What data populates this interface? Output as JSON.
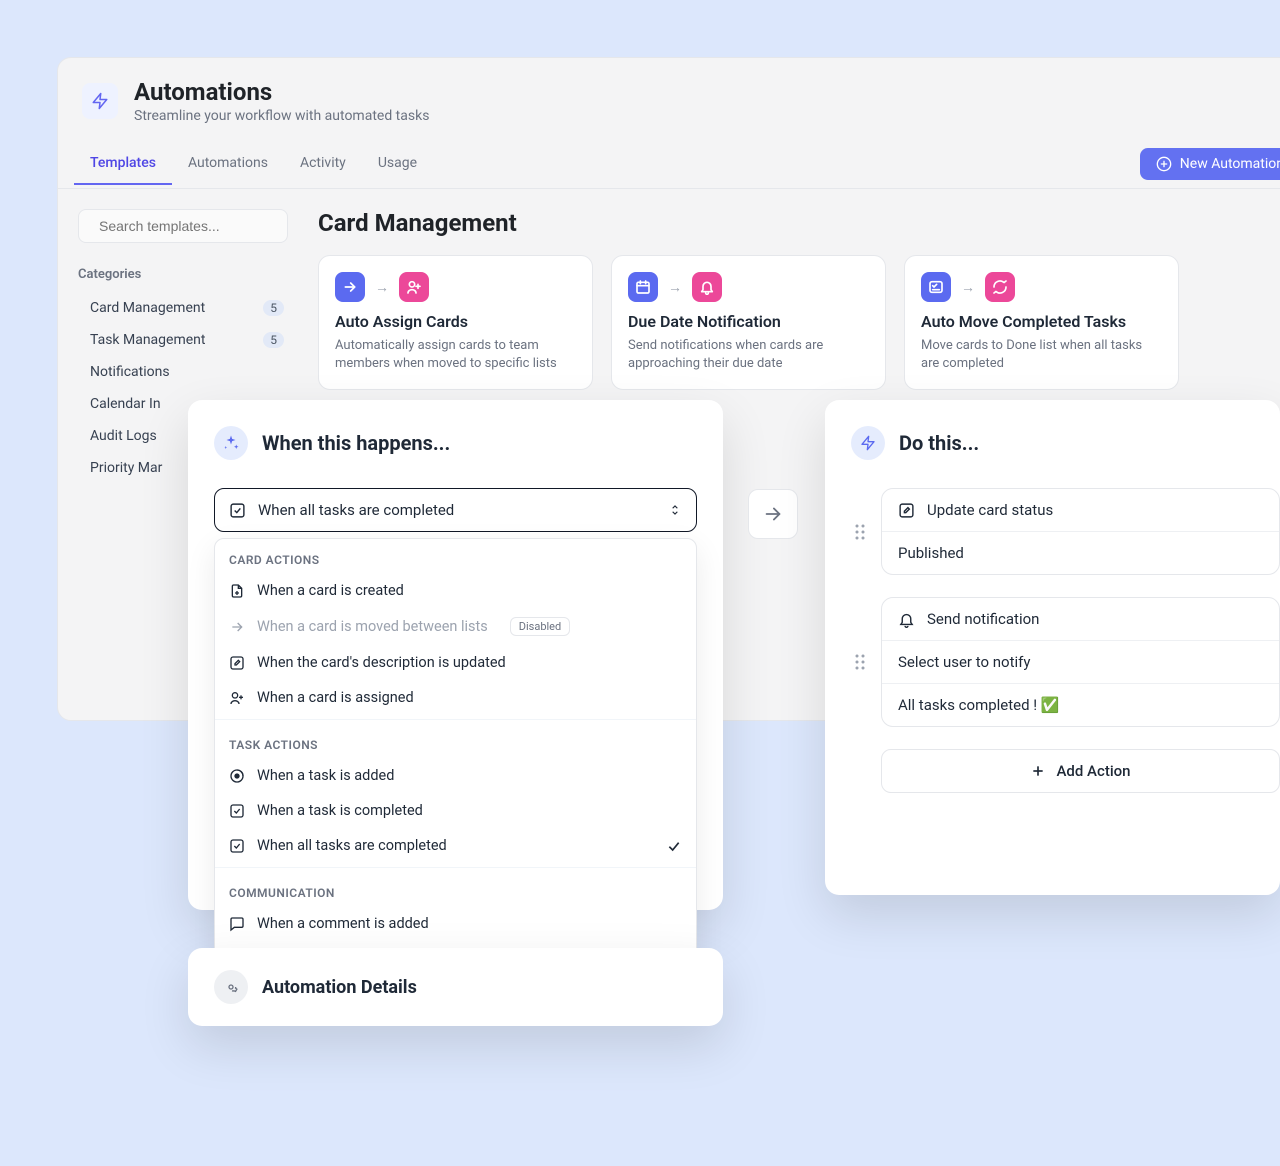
{
  "header": {
    "title": "Automations",
    "subtitle": "Streamline your workflow with automated tasks"
  },
  "tabs": [
    "Templates",
    "Automations",
    "Activity",
    "Usage"
  ],
  "new_button": "New Automation",
  "search_placeholder": "Search templates...",
  "categories_label": "Categories",
  "categories": [
    {
      "label": "Card Management",
      "count": "5"
    },
    {
      "label": "Task Management",
      "count": "5"
    },
    {
      "label": "Notifications",
      "count": ""
    },
    {
      "label": "Calendar In",
      "count": ""
    },
    {
      "label": "Audit Logs",
      "count": ""
    },
    {
      "label": "Priority Mar",
      "count": ""
    }
  ],
  "section_title": "Card Management",
  "template_cards": [
    {
      "title": "Auto Assign Cards",
      "desc": "Automatically assign cards to team members when moved to specific lists",
      "icon_a": "arrow",
      "icon_b": "user-plus"
    },
    {
      "title": "Due Date Notification",
      "desc": "Send notifications when cards are approaching their due date",
      "icon_a": "calendar",
      "icon_b": "bell"
    },
    {
      "title": "Auto Move Completed Tasks",
      "desc": "Move cards to Done list when all tasks are completed",
      "icon_a": "check-list",
      "icon_b": "refresh"
    }
  ],
  "trigger_panel": {
    "title": "When this happens...",
    "selected": "When all tasks are completed",
    "groups": [
      {
        "label": "CARD ACTIONS",
        "items": [
          {
            "icon": "file-plus",
            "label": "When a card is created"
          },
          {
            "icon": "arrow-right",
            "label": "When a card is moved between lists",
            "disabled": true,
            "badge": "Disabled"
          },
          {
            "icon": "edit-square",
            "label": "When the card's description is updated"
          },
          {
            "icon": "user-plus-outline",
            "label": "When a card is assigned"
          }
        ]
      },
      {
        "label": "TASK ACTIONS",
        "items": [
          {
            "icon": "target",
            "label": "When a task is added"
          },
          {
            "icon": "check-box",
            "label": "When a task is completed"
          },
          {
            "icon": "check-all",
            "label": "When all tasks are completed",
            "checked": true
          }
        ]
      },
      {
        "label": "COMMUNICATION",
        "items": [
          {
            "icon": "comment",
            "label": "When a comment is added"
          }
        ]
      }
    ]
  },
  "actions_panel": {
    "title": "Do this...",
    "blocks": [
      {
        "rows": [
          {
            "icon": "status-edit",
            "text": "Update card status"
          },
          {
            "text": "Published"
          }
        ]
      },
      {
        "rows": [
          {
            "icon": "bell-outline",
            "text": "Send notification"
          },
          {
            "text": "Select user to notify"
          },
          {
            "text": "All tasks completed ! ✅"
          }
        ]
      }
    ],
    "add_button": "Add Action"
  },
  "details_panel": {
    "title": "Automation Details"
  }
}
